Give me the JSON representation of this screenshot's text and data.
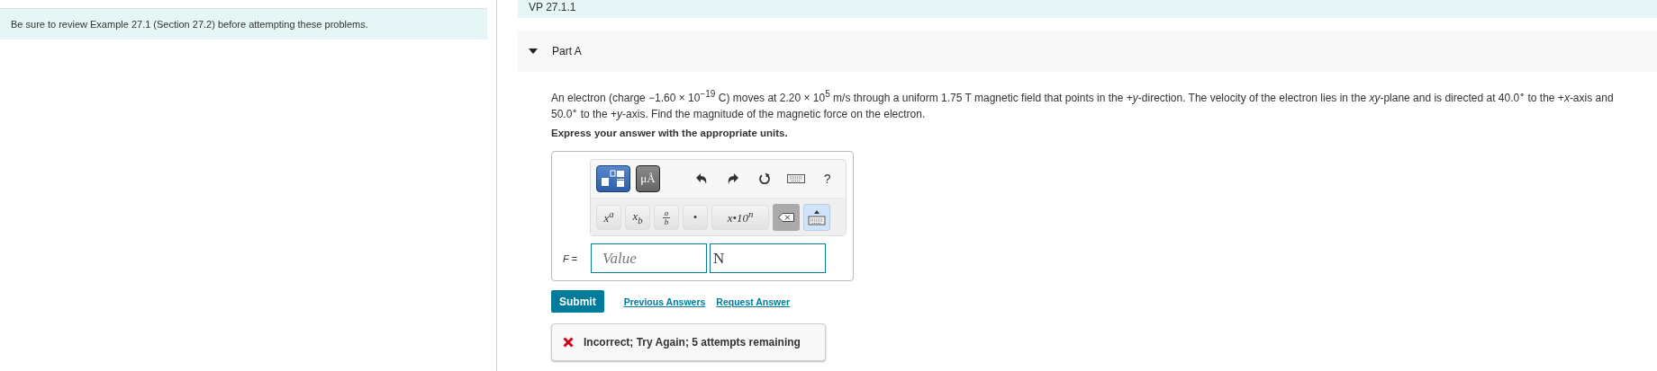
{
  "sidebar": {
    "notice": "Be sure to review Example 27.1 (Section 27.2) before attempting these problems."
  },
  "header": {
    "title": "VP 27.1.1"
  },
  "part": {
    "title": "Part A",
    "expanded": true,
    "problem": "An electron (charge −1.60 × 10$^{−19}$ C) moves at 2.20 × 10$^{5}$ m/s through a uniform 1.75 T magnetic field that points in the +*y*-direction. The velocity of the electron lies in the *xy*-plane and is directed at 40.0$^{∘}$ to the +*x*-axis and 50.0$^{∘}$ to the +*y*-axis. Find the magnitude of the magnetic force on the electron.",
    "instruction": "Express your answer with the appropriate units.",
    "toolbar": {
      "top": [
        {
          "kind": "templates",
          "selected": true
        },
        {
          "kind": "text",
          "text": "μÅ",
          "selected": false
        },
        {
          "kind": "undo"
        },
        {
          "kind": "redo"
        },
        {
          "kind": "reset"
        },
        {
          "kind": "keyboard"
        },
        {
          "kind": "text",
          "text": "?"
        }
      ],
      "keys": [
        {
          "kind": "text",
          "text": "x$^{a}$"
        },
        {
          "kind": "text",
          "text": "x$_{b}$"
        },
        {
          "kind": "fraction",
          "numerator": "a",
          "denominator": "b"
        },
        {
          "kind": "text",
          "text": "•"
        },
        {
          "kind": "text",
          "text": "x•10$^{n}$"
        },
        {
          "kind": "backspace"
        },
        {
          "kind": "keyboard-toggle"
        }
      ]
    },
    "answer": {
      "label": "*F* =",
      "value_placeholder": "Value",
      "unit": "N"
    },
    "buttons": {
      "submit": "Submit",
      "links": [
        "Previous Answers",
        "Request Answer"
      ]
    },
    "feedback": {
      "correct": false,
      "text": "Incorrect; Try Again; 5 attempts remaining"
    }
  }
}
